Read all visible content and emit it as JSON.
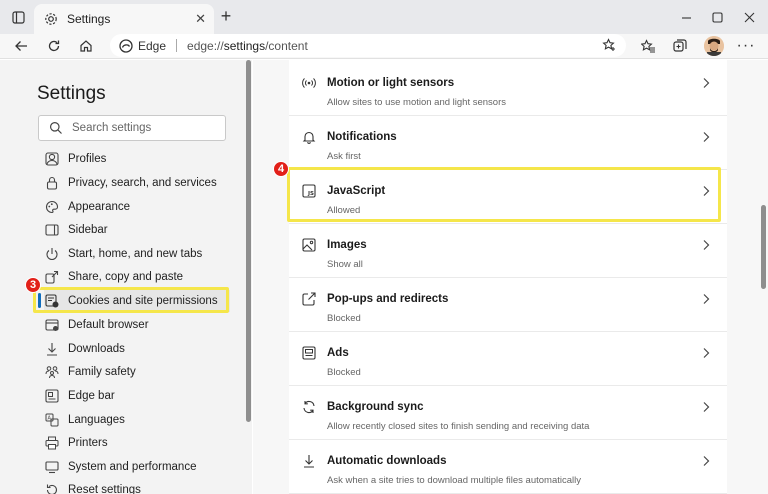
{
  "tab": {
    "title": "Settings"
  },
  "address": {
    "brand": "Edge",
    "url_scheme": "edge://",
    "url_host": "settings",
    "url_path": "/content"
  },
  "sidebar": {
    "title": "Settings",
    "search_placeholder": "Search settings",
    "items": [
      {
        "label": "Profiles",
        "icon": "profile-icon"
      },
      {
        "label": "Privacy, search, and services",
        "icon": "lock-icon"
      },
      {
        "label": "Appearance",
        "icon": "palette-icon"
      },
      {
        "label": "Sidebar",
        "icon": "sidebar-icon"
      },
      {
        "label": "Start, home, and new tabs",
        "icon": "power-icon"
      },
      {
        "label": "Share, copy and paste",
        "icon": "share-icon"
      },
      {
        "label": "Cookies and site permissions",
        "icon": "cookie-permissions-icon"
      },
      {
        "label": "Default browser",
        "icon": "browser-icon"
      },
      {
        "label": "Downloads",
        "icon": "download-icon"
      },
      {
        "label": "Family safety",
        "icon": "family-icon"
      },
      {
        "label": "Edge bar",
        "icon": "edge-bar-icon"
      },
      {
        "label": "Languages",
        "icon": "languages-icon"
      },
      {
        "label": "Printers",
        "icon": "printer-icon"
      },
      {
        "label": "System and performance",
        "icon": "system-icon"
      },
      {
        "label": "Reset settings",
        "icon": "reset-icon"
      }
    ]
  },
  "permissions": [
    {
      "title": "Motion or light sensors",
      "subtitle": "Allow sites to use motion and light sensors",
      "icon": "sensor-icon"
    },
    {
      "title": "Notifications",
      "subtitle": "Ask first",
      "icon": "bell-icon"
    },
    {
      "title": "JavaScript",
      "subtitle": "Allowed",
      "icon": "javascript-icon"
    },
    {
      "title": "Images",
      "subtitle": "Show all",
      "icon": "image-icon"
    },
    {
      "title": "Pop-ups and redirects",
      "subtitle": "Blocked",
      "icon": "popup-icon"
    },
    {
      "title": "Ads",
      "subtitle": "Blocked",
      "icon": "ads-icon"
    },
    {
      "title": "Background sync",
      "subtitle": "Allow recently closed sites to finish sending and receiving data",
      "icon": "sync-icon"
    },
    {
      "title": "Automatic downloads",
      "subtitle": "Ask when a site tries to download multiple files automatically",
      "icon": "download-icon"
    }
  ],
  "annotations": {
    "step_left": "3",
    "step_right": "4"
  },
  "colors": {
    "highlight": "#f5e64a",
    "badge": "#e22019",
    "accent": "#0f6cbd"
  }
}
